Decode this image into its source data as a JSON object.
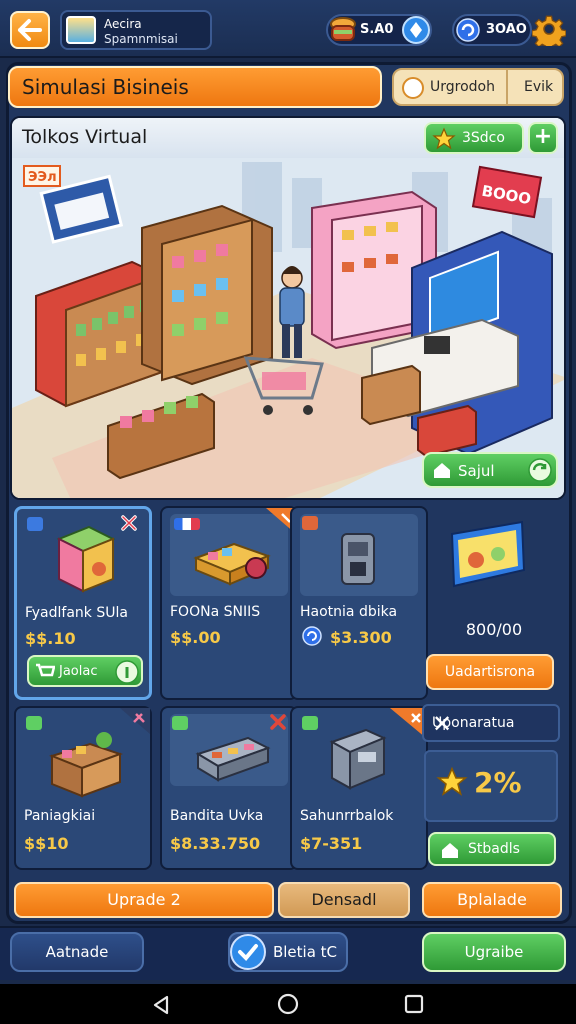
{
  "topbar": {
    "profile_name": "Aecira",
    "profile_sub": "Spamnmisai",
    "currency_1": "S.A0",
    "currency_2": "3OAO"
  },
  "header": {
    "title": "Simulasi Bisineis",
    "seg_a": "Urgrodoh",
    "seg_b": "Evik"
  },
  "scene": {
    "title": "Tolkos Virtual",
    "badge": "3Sdco",
    "plus": "+",
    "sign_left": "ЭЭл",
    "sign_right": "BOOO",
    "button": "Sajul"
  },
  "cards": [
    {
      "name": "Fyadlfank SUla",
      "price": "$$.10",
      "button": "Jaolac"
    },
    {
      "name": "FOONa SNIIS",
      "price": "$$.00"
    },
    {
      "name": "Haotnia dbika",
      "price": "$3.300"
    },
    {
      "name": "Paniagkiai",
      "price": "$$10"
    },
    {
      "name": "Bandita Uvka",
      "price": "$8.33.750"
    },
    {
      "name": "Sahunrrbalok",
      "price": "$7-351"
    }
  ],
  "right": {
    "value": "800/00",
    "orange_btn": "Uadartisrona",
    "upgrade_label": "Uponaratua",
    "percent": "2%",
    "green_btn": "Stbadls"
  },
  "actions": {
    "upgrade": "Uprade 2",
    "densadl": "Densadl",
    "bplalade": "Bplalade"
  },
  "footer": {
    "left": "Aatnade",
    "center": "Bletia tC",
    "right": "Ugraibe"
  },
  "colors": {
    "orange": "#ee7710",
    "green": "#2f9a36",
    "navy": "#20365f",
    "price": "#f7c948"
  }
}
